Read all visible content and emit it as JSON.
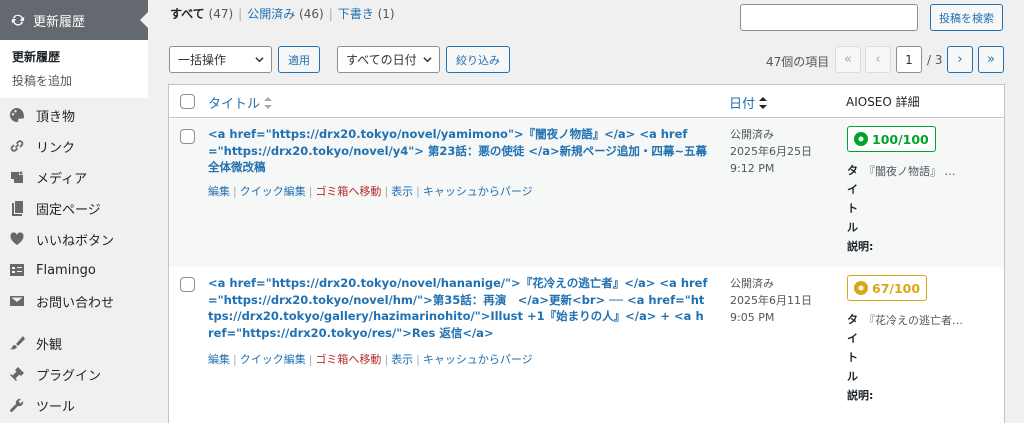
{
  "sidebar": {
    "current": "更新履歴",
    "submenu": [
      "更新履歴",
      "投稿を追加"
    ],
    "items": [
      {
        "label": "頂き物",
        "icon": "palette-icon"
      },
      {
        "label": "リンク",
        "icon": "link-icon"
      },
      {
        "label": "メディア",
        "icon": "media-icon"
      },
      {
        "label": "固定ページ",
        "icon": "pages-icon"
      },
      {
        "label": "いいねボタン",
        "icon": "heart-icon"
      },
      {
        "label": "Flamingo",
        "icon": "flamingo-icon"
      },
      {
        "label": "お問い合わせ",
        "icon": "mail-icon"
      },
      {
        "label": "外観",
        "icon": "brush-icon"
      },
      {
        "label": "プラグイン",
        "icon": "plugin-icon"
      },
      {
        "label": "ツール",
        "icon": "wrench-icon"
      }
    ]
  },
  "views": {
    "all": "すべて",
    "all_count": "(47)",
    "published": "公開済み",
    "published_count": "(46)",
    "draft": "下書き",
    "draft_count": "(1)"
  },
  "search": {
    "button": "投稿を検索",
    "value": ""
  },
  "toolbar": {
    "bulk": "一括操作",
    "apply": "適用",
    "dates": "すべての日付",
    "filter": "絞り込み"
  },
  "pagination": {
    "items": "47個の項目",
    "first": "«",
    "prev": "‹",
    "current": "1",
    "total": "/ 3",
    "next": "›",
    "last": "»"
  },
  "columns": {
    "title": "タイトル",
    "date": "日付",
    "aioseo": "AIOSEO 詳細"
  },
  "rows": [
    {
      "title": "<a href=\"https://drx20.tokyo/novel/yamimono\">『闇夜ノ物語』</a> <a href=\"https://drx20.tokyo/novel/y4\"> 第23話：悪の使徒 </a>新規ページ追加・四幕~五幕全体微改稿",
      "actions": {
        "edit": "編集",
        "quick": "クイック編集",
        "trash": "ゴミ箱へ移動",
        "view": "表示",
        "purge": "キャッシュからパージ"
      },
      "status": "公開済み",
      "date": "2025年6月25日",
      "time": "9:12 PM",
      "score": "100/100",
      "score_color": "#00a32a",
      "seo_title_label": "タイトル",
      "seo_title": "『闇夜ノ物語』 …",
      "seo_desc_label": "説明:"
    },
    {
      "title": "<a href=\"https://drx20.tokyo/novel/hananige/\">『花冷えの逃亡者』</a> <a href=\"https://drx20.tokyo/novel/hm/\">第35話：再演　</a>更新<br> ── <a href=\"https://drx20.tokyo/gallery/hazimarinohito/\">Illust +1『始まりの人』</a> + <a href=\"https://drx20.tokyo/res/\">Res 返信</a>",
      "actions": {
        "edit": "編集",
        "quick": "クイック編集",
        "trash": "ゴミ箱へ移動",
        "view": "表示",
        "purge": "キャッシュからパージ"
      },
      "status": "公開済み",
      "date": "2025年6月11日",
      "time": "9:05 PM",
      "score": "67/100",
      "score_color": "#dba617",
      "seo_title_label": "タイトル",
      "seo_title": "『花冷えの逃亡者…",
      "seo_desc_label": "説明:"
    }
  ]
}
